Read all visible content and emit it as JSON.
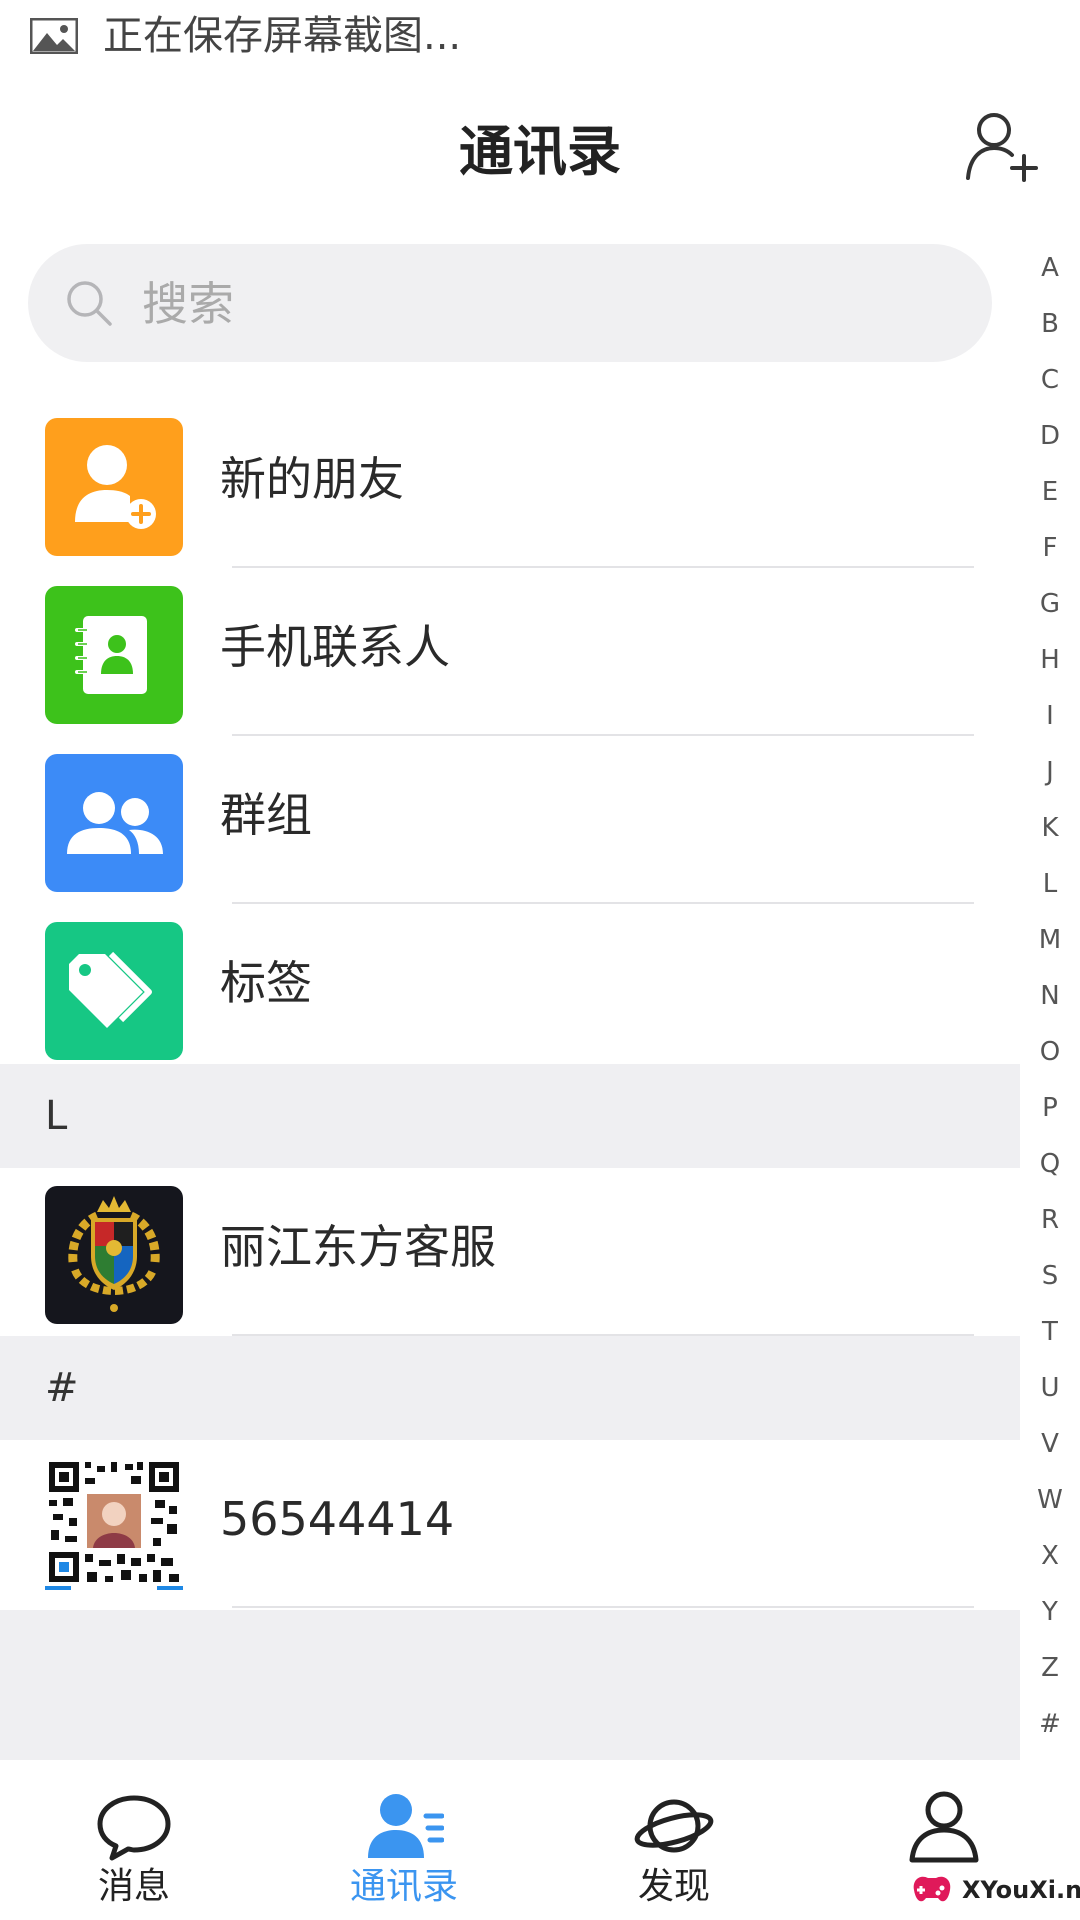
{
  "status_bar": {
    "text": "正在保存屏幕截图..."
  },
  "header": {
    "title": "通讯录"
  },
  "search": {
    "placeholder": "搜索"
  },
  "function_items": [
    {
      "label": "新的朋友",
      "color": "#FF9F1C",
      "icon": "add-friend-icon"
    },
    {
      "label": "手机联系人",
      "color": "#3DC21B",
      "icon": "phone-contacts-icon"
    },
    {
      "label": "群组",
      "color": "#3C8BF7",
      "icon": "group-icon"
    },
    {
      "label": "标签",
      "color": "#16C784",
      "icon": "tag-icon"
    }
  ],
  "sections": [
    {
      "header": "L",
      "contacts": [
        {
          "name": "丽江东方客服"
        }
      ]
    },
    {
      "header": "#",
      "contacts": [
        {
          "name": "56544414"
        }
      ]
    }
  ],
  "alphabet_index": [
    "A",
    "B",
    "C",
    "D",
    "E",
    "F",
    "G",
    "H",
    "I",
    "J",
    "K",
    "L",
    "M",
    "N",
    "O",
    "P",
    "Q",
    "R",
    "S",
    "T",
    "U",
    "V",
    "W",
    "X",
    "Y",
    "Z",
    "#"
  ],
  "tabs": [
    {
      "label": "消息",
      "icon": "chat-bubble-icon",
      "active": false
    },
    {
      "label": "通讯录",
      "icon": "contacts-icon",
      "active": true
    },
    {
      "label": "发现",
      "icon": "planet-icon",
      "active": false
    },
    {
      "label": "",
      "icon": "profile-icon",
      "active": false
    }
  ],
  "watermark": {
    "text": "XYouXi.net"
  },
  "colors": {
    "accent": "#3B95F0",
    "section_bg": "#EFEFF2"
  }
}
